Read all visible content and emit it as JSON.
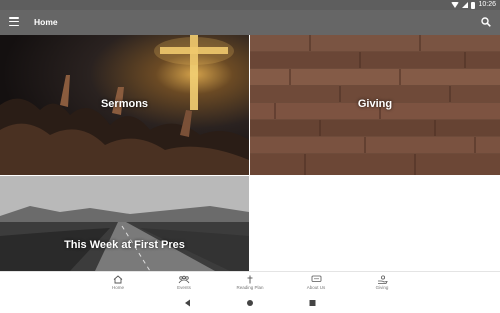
{
  "status_bar": {
    "time": "10:26"
  },
  "app_bar": {
    "title": "Home"
  },
  "tiles": {
    "sermons": "Sermons",
    "giving": "Giving",
    "this_week": "This Week at First Pres"
  },
  "bottom_nav": {
    "items": [
      {
        "label": "Home",
        "icon": "home-icon"
      },
      {
        "label": "Events",
        "icon": "events-icon"
      },
      {
        "label": "Reading Plan",
        "icon": "cross-icon"
      },
      {
        "label": "About Us",
        "icon": "chat-icon"
      },
      {
        "label": "Giving",
        "icon": "giving-hand-icon"
      }
    ]
  },
  "colors": {
    "app_bar": "#666666",
    "status_bar": "#5e5e5e"
  }
}
